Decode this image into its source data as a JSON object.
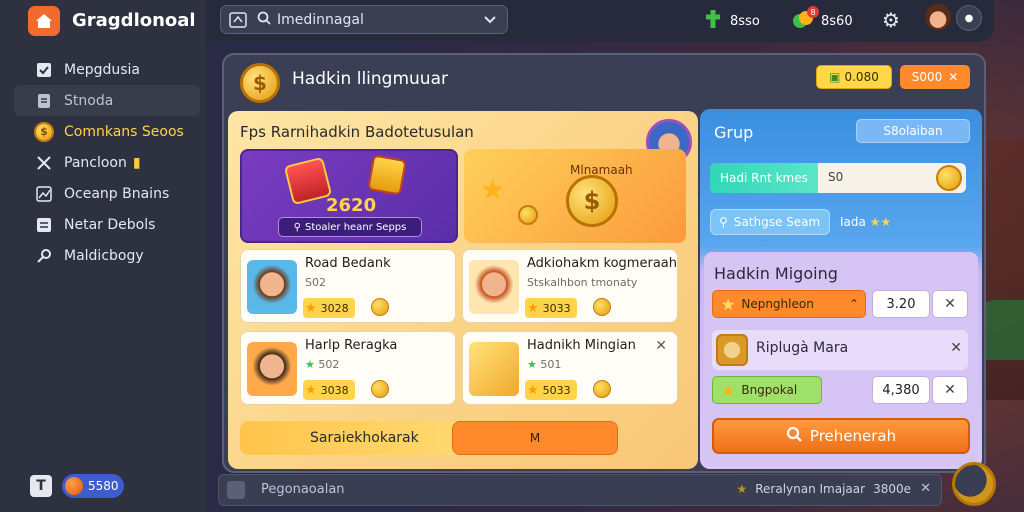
{
  "app": {
    "title": "Gragdlonoal"
  },
  "sidebar": {
    "items": [
      {
        "label": "Mepgdusia",
        "icon": "checkbox-icon"
      },
      {
        "label": "Stnoda",
        "icon": "document-icon"
      },
      {
        "label": "Comnkans Seoos",
        "icon": "coin-icon"
      },
      {
        "label": "Pancloon",
        "icon": "swords-icon"
      },
      {
        "label": "Oceanp Bnains",
        "icon": "chart-icon"
      },
      {
        "label": "Netar Debols",
        "icon": "list-icon"
      },
      {
        "label": "Maldicbogy",
        "icon": "link-icon"
      }
    ],
    "footer": {
      "t_label": "T",
      "balance": "5580"
    }
  },
  "topbar": {
    "search_value": "Imedinnagal",
    "stat1": "8sso",
    "stat2": "8s60",
    "stat2_badge": "8"
  },
  "window": {
    "title": "Hadkin llingmuuar",
    "pill_yellow": "0.080",
    "pill_orange": "S000",
    "main": {
      "heading": "Fps Rarnihadkin Badotetusulan",
      "banner1": {
        "amount": "2620",
        "cta": "Stoaler heanr Sepps"
      },
      "banner2": {
        "label": "Mlnamaah"
      },
      "cards": [
        {
          "name": "Road Bedank",
          "sub": "S02",
          "price": "3028"
        },
        {
          "name": "Adkiohakm kogmeraah",
          "sub": "Stskalhbon tmonaty",
          "price": "3033"
        },
        {
          "name": "Harlp Reragka",
          "sub": "502",
          "price": "3038"
        },
        {
          "name": "Hadnikh Mingian",
          "sub": "501",
          "price": "5033"
        }
      ],
      "bottom_btn1": "Saraiekhokarak",
      "bottom_btn2": "M"
    },
    "right": {
      "title": "Grup",
      "top_btn": "S8olaiban",
      "progress_label": "Hadi Rnt kmes",
      "progress_value": "S0",
      "progress_fraction": 0.42,
      "chip": "Sathgse Seam",
      "rating": "Iada",
      "sub_title": "Hadkin Migoing",
      "row1": {
        "label": "Nepnghleon",
        "value": "3.20"
      },
      "card": {
        "name": "Riplugà Mara"
      },
      "row2": {
        "label": "Bngpokal",
        "value": "4,380"
      },
      "main_btn": "Prehenerah"
    }
  },
  "bottombar": {
    "label": "Pegonaoalan",
    "right_text": "Reralynan Imajaar",
    "right_value": "3800e"
  },
  "colors": {
    "accent_orange": "#ff8a2c",
    "accent_yellow": "#ffd44a",
    "sidebar_bg": "#2d3140",
    "highlight_text": "#ffd34a"
  }
}
